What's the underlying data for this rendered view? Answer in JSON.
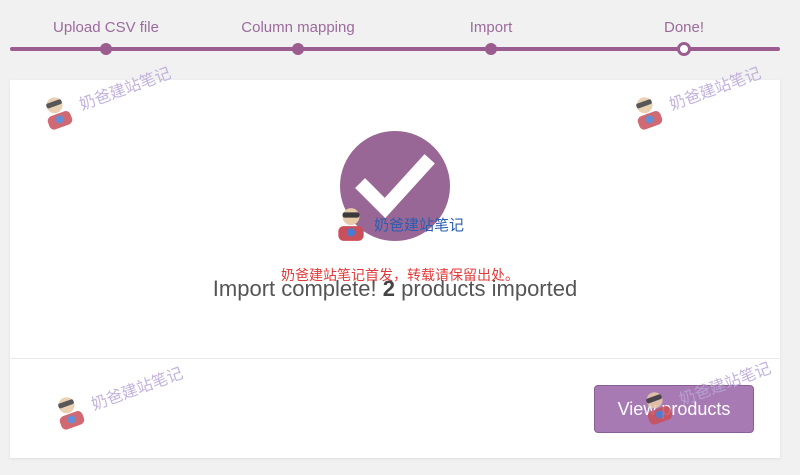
{
  "steps": [
    {
      "label": "Upload CSV file",
      "state": "done"
    },
    {
      "label": "Column mapping",
      "state": "done"
    },
    {
      "label": "Import",
      "state": "done"
    },
    {
      "label": "Done!",
      "state": "current"
    }
  ],
  "main": {
    "message_prefix": "Import complete!",
    "count": "2",
    "message_suffix": "products imported",
    "view_button_label": "View products"
  },
  "watermark": {
    "brand_text": "奶爸建站笔记",
    "notice_text": "奶爸建站笔记首发，转载请保留出处。"
  },
  "colors": {
    "accent": "#9b5c8f",
    "check_circle": "#996796",
    "button": "#a87ab4",
    "notice": "#e23b3b"
  },
  "icons": {
    "check": "check-icon",
    "mascot": "mascot-icon"
  }
}
